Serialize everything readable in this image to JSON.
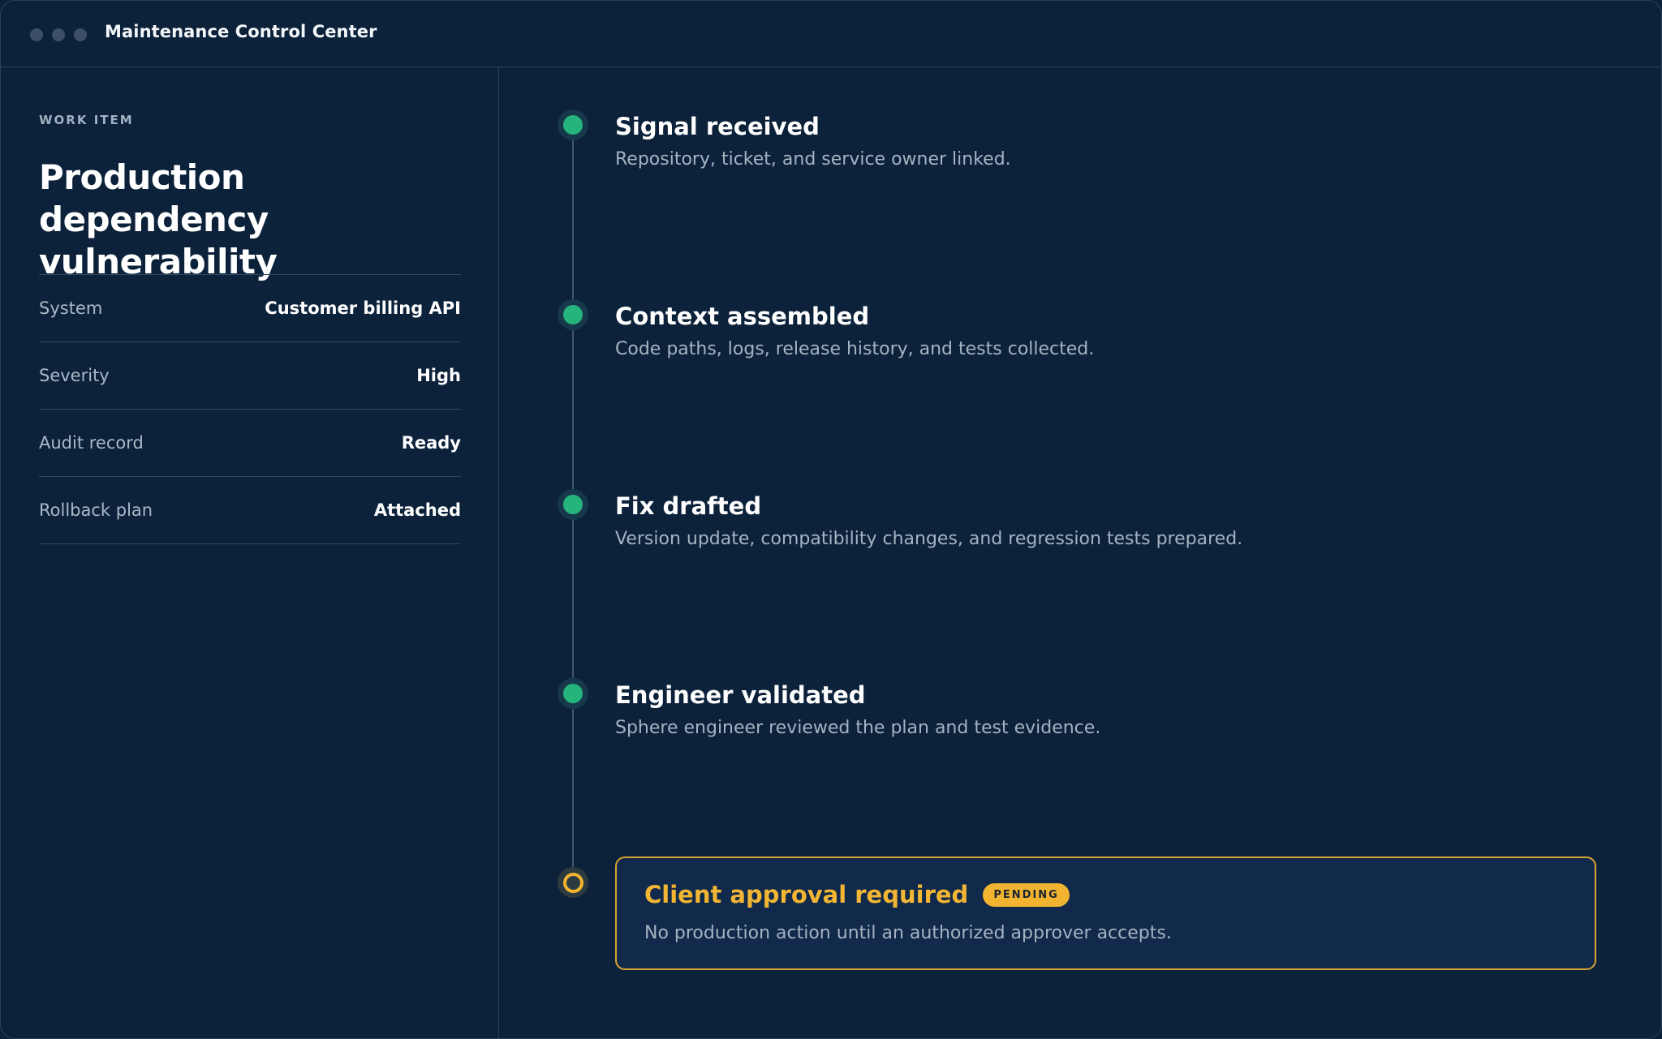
{
  "window": {
    "title": "Maintenance Control Center"
  },
  "sidebar": {
    "eyebrow": "WORK ITEM",
    "title": "Production dependency vulnerability",
    "properties": [
      {
        "label": "System",
        "value": "Customer billing API"
      },
      {
        "label": "Severity",
        "value": "High"
      },
      {
        "label": "Audit record",
        "value": "Ready"
      },
      {
        "label": "Rollback plan",
        "value": "Attached"
      }
    ]
  },
  "timeline": {
    "steps": [
      {
        "title": "Signal received",
        "description": "Repository, ticket, and service owner linked.",
        "status": "complete"
      },
      {
        "title": "Context assembled",
        "description": "Code paths, logs, release history, and tests collected.",
        "status": "complete"
      },
      {
        "title": "Fix drafted",
        "description": "Version update, compatibility changes, and regression tests prepared.",
        "status": "complete"
      },
      {
        "title": "Engineer validated",
        "description": "Sphere engineer reviewed the plan and test evidence.",
        "status": "complete"
      }
    ],
    "approval": {
      "title": "Client approval required",
      "badge": "PENDING",
      "description": "No production action until an authorized approver accepts.",
      "status": "pending"
    }
  },
  "colors": {
    "background": "#0c223a",
    "complete": "#25b57c",
    "pending": "#f2b430",
    "border": "#28425a"
  }
}
